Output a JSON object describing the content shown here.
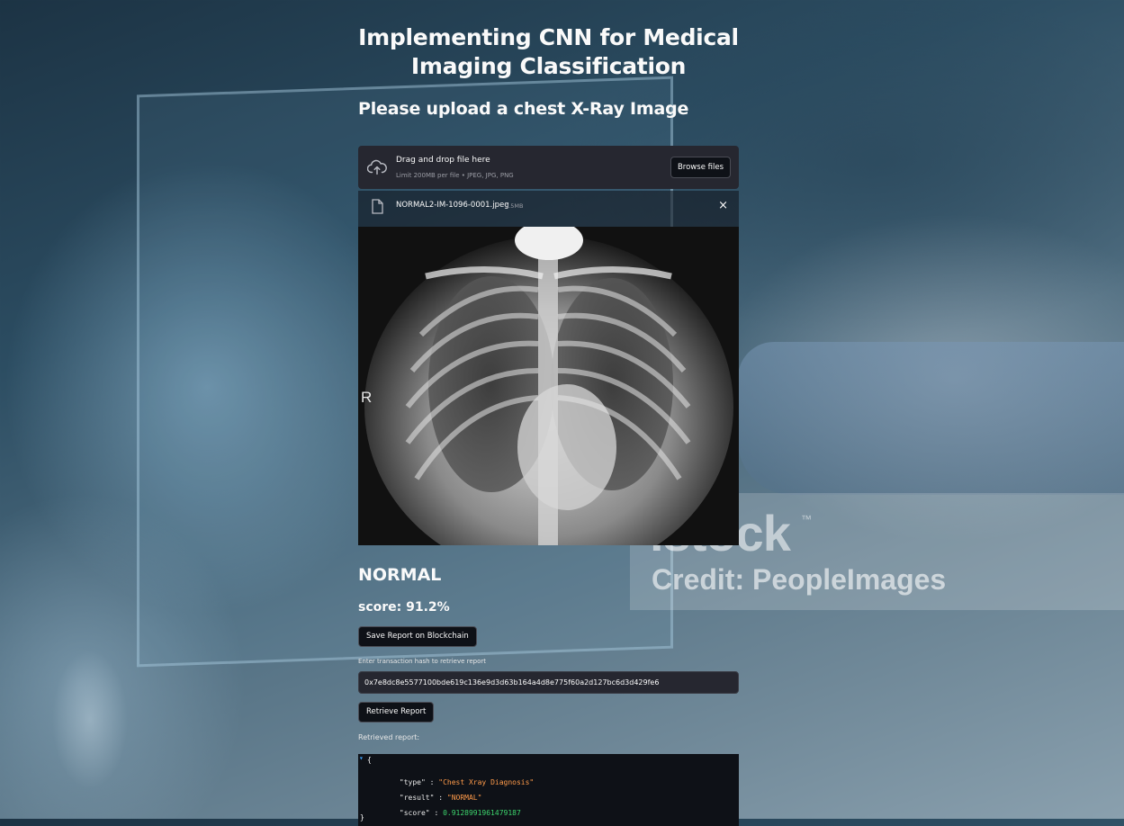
{
  "header": {
    "title": "Implementing CNN for Medical Imaging Classification",
    "subtitle": "Please upload a chest X-Ray Image"
  },
  "uploader": {
    "drop_text": "Drag and drop file here",
    "limit_text": "Limit 200MB per file • JPEG, JPG, PNG",
    "browse_label": "Browse files",
    "icon": "cloud-upload-icon"
  },
  "uploaded_file": {
    "name": "NORMAL2-IM-1096-0001.jpeg",
    "size": "0.5MB",
    "close_glyph": "×",
    "icon": "file-icon"
  },
  "image": {
    "marker": "R"
  },
  "result": {
    "label": "NORMAL",
    "score": "score: 91.2%"
  },
  "actions": {
    "save_label": "Save Report on Blockchain",
    "hash_prompt": "Enter transaction hash to retrieve report",
    "hash_value": "0x7e8dc8e5577100bde619c136e9d3d63b164a4d8e775f60a2d127bc6d3d429fe6",
    "retrieve_label": "Retrieve Report",
    "retrieved_label": "Retrieved report:"
  },
  "report_json": {
    "open_brace": "{",
    "close_brace": "}",
    "type_key": "\"type\"",
    "type_value": "\"Chest Xray Diagnosis\"",
    "result_key": "\"result\"",
    "result_value": "\"NORMAL\"",
    "score_key": "\"score\"",
    "score_value": "0.9128991961479187"
  },
  "watermark": {
    "logo": "istock",
    "trademark": "™",
    "credit": "Credit: PeopleImages"
  },
  "colors": {
    "widget_bg": "#262730",
    "app_bg": "#0e1117",
    "json_string": "#ff9b4a",
    "json_number": "#3dd56d"
  }
}
